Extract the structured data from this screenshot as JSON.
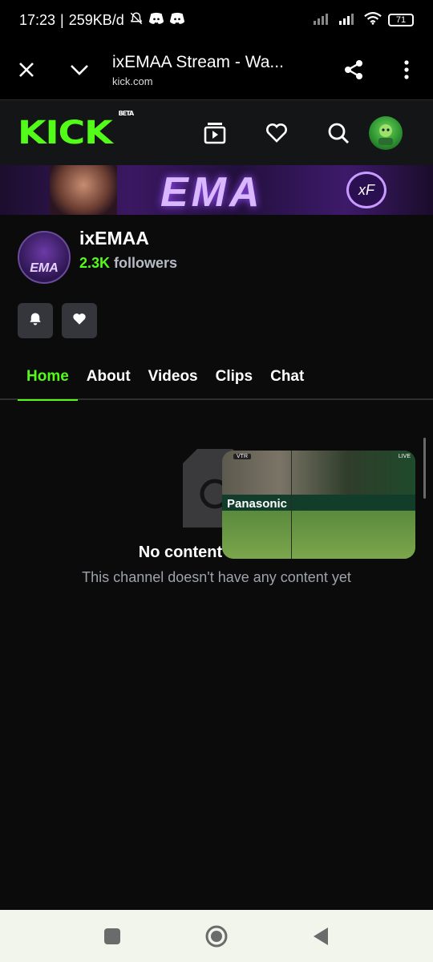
{
  "status_bar": {
    "time": "17:23",
    "speed": "259KB/d",
    "battery": "71"
  },
  "browser": {
    "title": "ixEMAA Stream - Wa...",
    "url": "kick.com"
  },
  "header": {
    "logo": "KICK",
    "beta": "BETA"
  },
  "banner": {
    "text": "EMA",
    "coin_text": "xF"
  },
  "channel": {
    "avatar_text": "EMA",
    "name": "ixEMAA",
    "followers_count": "2.3K",
    "followers_label": "followers"
  },
  "tabs": [
    {
      "label": "Home",
      "active": true
    },
    {
      "label": "About",
      "active": false
    },
    {
      "label": "Videos",
      "active": false
    },
    {
      "label": "Clips",
      "active": false
    },
    {
      "label": "Chat",
      "active": false
    }
  ],
  "empty_state": {
    "title": "No content available",
    "subtitle": "This channel doesn't have any content yet"
  },
  "pip": {
    "brand": "Panasonic",
    "vtr": "VTR",
    "live": "LIVE"
  },
  "colors": {
    "accent": "#53fc18",
    "background": "#0b0b0c",
    "header": "#141517",
    "button": "#34363b",
    "muted_text": "#9ea3ab"
  }
}
